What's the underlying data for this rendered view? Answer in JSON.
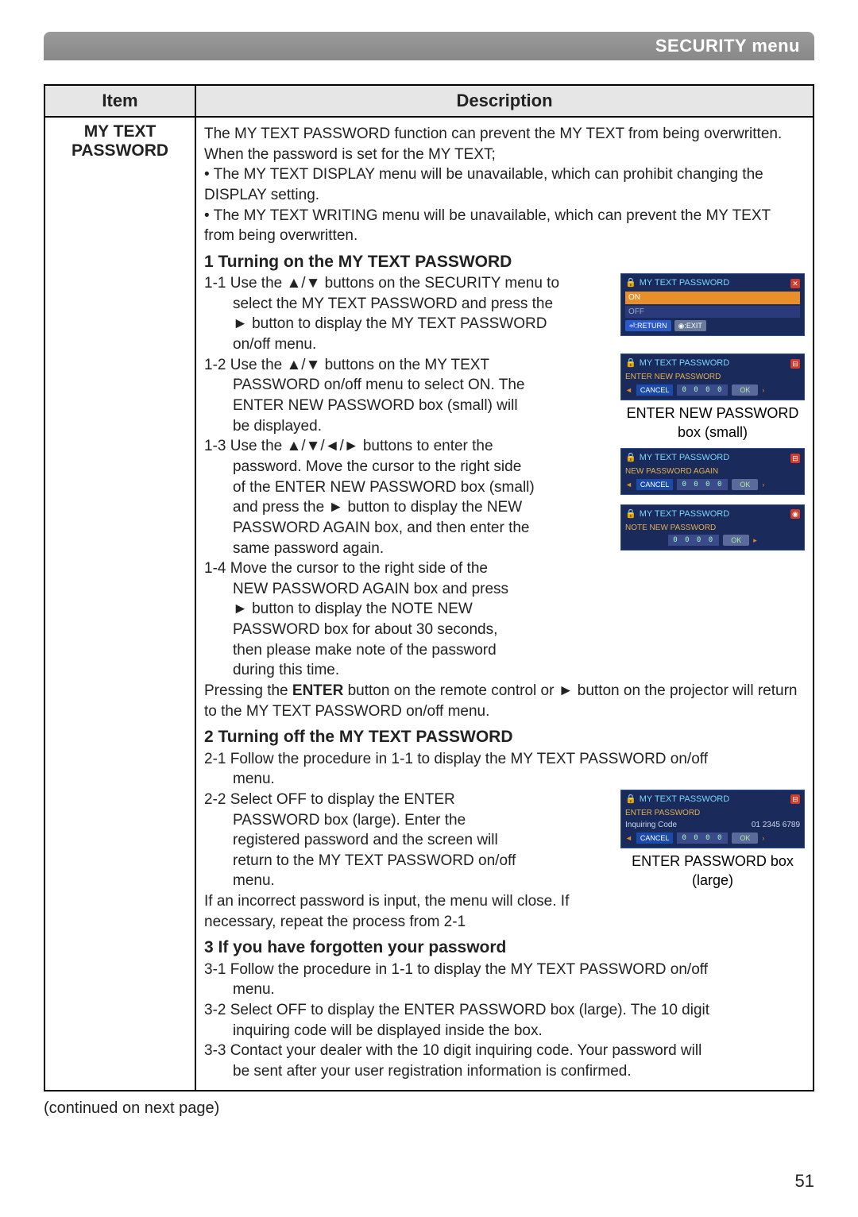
{
  "header": {
    "title": "SECURITY menu"
  },
  "table": {
    "headers": {
      "item": "Item",
      "description": "Description"
    },
    "item_label": "MY TEXT PASSWORD",
    "intro": {
      "p1": "The MY TEXT PASSWORD function can prevent the MY TEXT from being overwritten. When the password is set for the MY TEXT;",
      "b1": "• The MY TEXT DISPLAY menu will be unavailable, which can prohibit changing the DISPLAY setting.",
      "b2": "• The MY TEXT WRITING menu will be unavailable, which can prevent the MY TEXT from being overwritten."
    },
    "s1": {
      "title": "1 Turning on the MY TEXT PASSWORD",
      "l1a": "1-1 Use the ▲/▼ buttons on the SECURITY menu to select the MY TEXT PASSWORD and press the ► button to display the MY TEXT PASSWORD on/off menu.",
      "l2a": "1-2 Use the ▲/▼ buttons on the MY TEXT PASSWORD on/off menu to select ON. The ENTER NEW PASSWORD box (small) will be displayed.",
      "l3a": "1-3 Use the ▲/▼/◄/► buttons to enter the password. Move the cursor to the right side of the ENTER NEW PASSWORD box (small) and press the ► button to display the NEW PASSWORD AGAIN box, and then enter the same password again.",
      "l4a": "1-4 Move the cursor to the right side of the NEW PASSWORD AGAIN box and press ► button to display the NOTE NEW PASSWORD box for about 30 seconds, then please make note of the password during this time.",
      "tail": "Pressing the ENTER button on the remote control or ► button on the projector will return to the MY TEXT PASSWORD on/off menu."
    },
    "s2": {
      "title": "2 Turning off the MY TEXT PASSWORD",
      "l1": "2-1 Follow the procedure in 1-1 to display the MY TEXT PASSWORD on/off menu.",
      "l2": "2-2 Select OFF to display the ENTER PASSWORD box (large). Enter the registered password and the screen will return to the MY TEXT PASSWORD on/off menu.",
      "tail": "If an incorrect password is input, the menu will close. If necessary, repeat the process from 2-1"
    },
    "s3": {
      "title": "3 If you have forgotten your password",
      "l1": "3-1 Follow the procedure in 1-1 to display the MY TEXT PASSWORD on/off menu.",
      "l2": "3-2 Select OFF to display the ENTER PASSWORD box (large). The 10 digit inquiring code will be displayed inside the box.",
      "l3": "3-3 Contact your dealer with the 10 digit inquiring code. Your password will be sent after your user registration information is confirmed."
    }
  },
  "osd": {
    "title": "MY TEXT PASSWORD",
    "on": "ON",
    "off": "OFF",
    "return": "⏎:RETURN",
    "exit": "◉:EXIT",
    "enter_new": "ENTER NEW PASSWORD",
    "new_again": "NEW PASSWORD AGAIN",
    "note_new": "NOTE NEW PASSWORD",
    "enter_pw": "ENTER PASSWORD",
    "inquiring": "Inquiring Code",
    "inq_code": "01 2345 6789",
    "cancel": "CANCEL",
    "ok": "OK",
    "digits": "0 0 0 0",
    "caption_small": "ENTER NEW PASSWORD box (small)",
    "caption_large": "ENTER PASSWORD box (large)"
  },
  "footer": {
    "continued": "(continued on next page)",
    "page": "51"
  }
}
